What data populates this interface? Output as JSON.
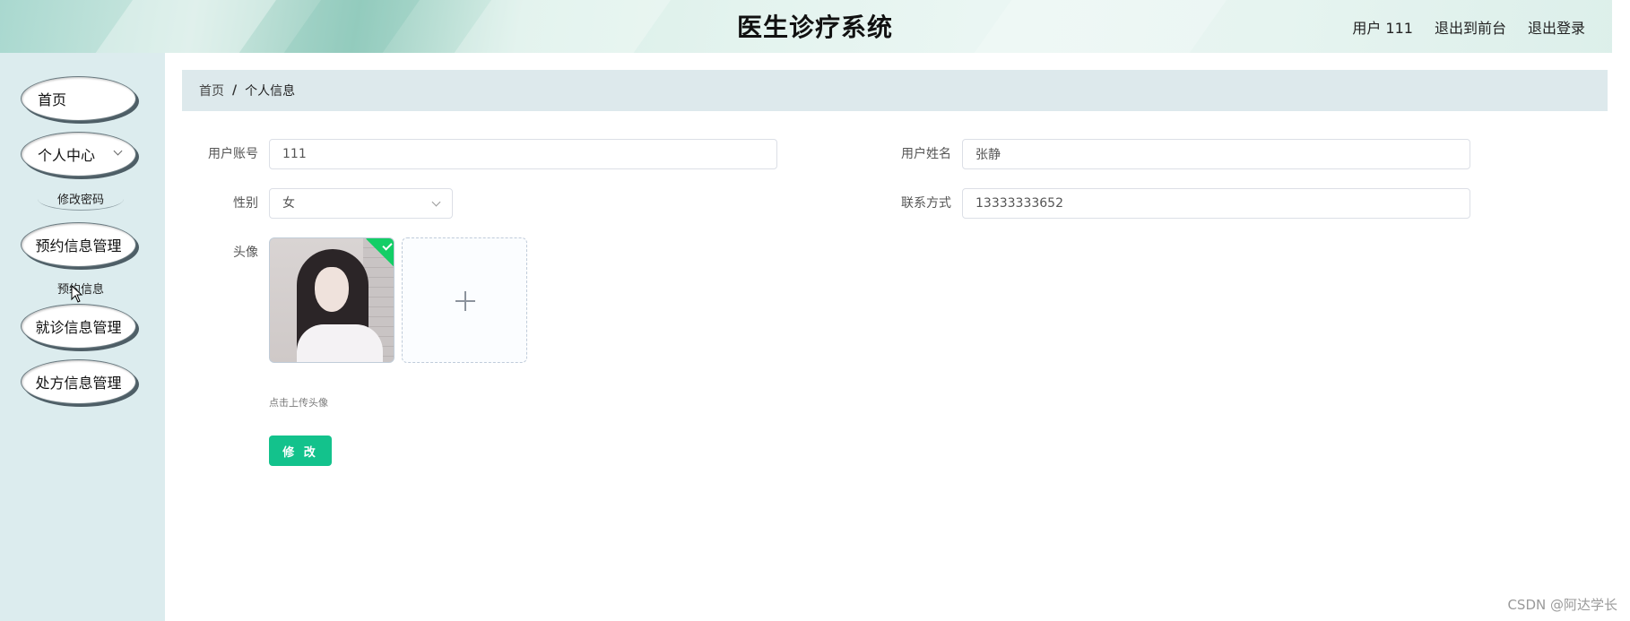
{
  "header": {
    "title": "医生诊疗系统",
    "user": "用户 111",
    "back_to_front": "退出到前台",
    "logout": "退出登录"
  },
  "sidebar": {
    "items": [
      {
        "label": "首页"
      },
      {
        "label": "个人中心",
        "expanded": true
      },
      {
        "label": "修改密码",
        "sub": true
      },
      {
        "label": "预约信息管理"
      },
      {
        "label": "预约信息",
        "sub": true
      },
      {
        "label": "就诊信息管理"
      },
      {
        "label": "处方信息管理"
      }
    ]
  },
  "breadcrumb": {
    "home": "首页",
    "separator": "/",
    "current": "个人信息"
  },
  "form": {
    "account": {
      "label": "用户账号",
      "value": "111"
    },
    "name": {
      "label": "用户姓名",
      "value": "张静"
    },
    "gender": {
      "label": "性别",
      "value": "女"
    },
    "phone": {
      "label": "联系方式",
      "value": "13333333652"
    },
    "avatar": {
      "label": "头像",
      "hint": "点击上传头像"
    },
    "submit_label": "修 改"
  },
  "watermark": "CSDN @阿达学长",
  "colors": {
    "accent": "#13c28c",
    "success_badge": "#13ce66",
    "sidebar_bg": "#dcecee",
    "breadcrumb_bg": "#dde9ec"
  }
}
